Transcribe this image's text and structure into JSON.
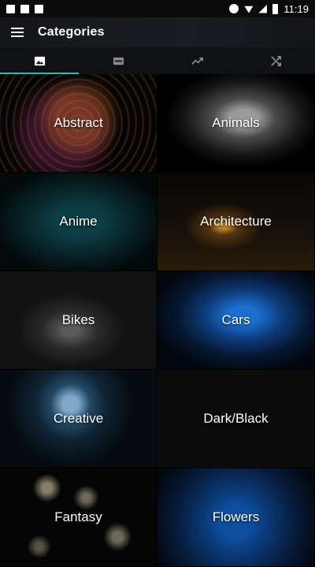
{
  "status_bar": {
    "time": "11:19",
    "left_icons": [
      "image-icon",
      "stop-icon",
      "a-icon"
    ],
    "right_icons": [
      "dnd-icon",
      "wifi-icon",
      "signal-icon",
      "battery-icon"
    ]
  },
  "app_bar": {
    "title": "Categories",
    "menu_icon": "hamburger-menu-icon"
  },
  "tabs": [
    {
      "icon": "image-icon",
      "active": true
    },
    {
      "icon": "new-badge-icon",
      "active": false
    },
    {
      "icon": "trending-icon",
      "active": false
    },
    {
      "icon": "shuffle-icon",
      "active": false
    }
  ],
  "accent_color": "#18c6b6",
  "categories": [
    {
      "label": "Abstract"
    },
    {
      "label": "Animals"
    },
    {
      "label": "Anime"
    },
    {
      "label": "Architecture"
    },
    {
      "label": "Bikes"
    },
    {
      "label": "Cars"
    },
    {
      "label": "Creative"
    },
    {
      "label": "Dark/Black"
    },
    {
      "label": "Fantasy"
    },
    {
      "label": "Flowers"
    }
  ]
}
